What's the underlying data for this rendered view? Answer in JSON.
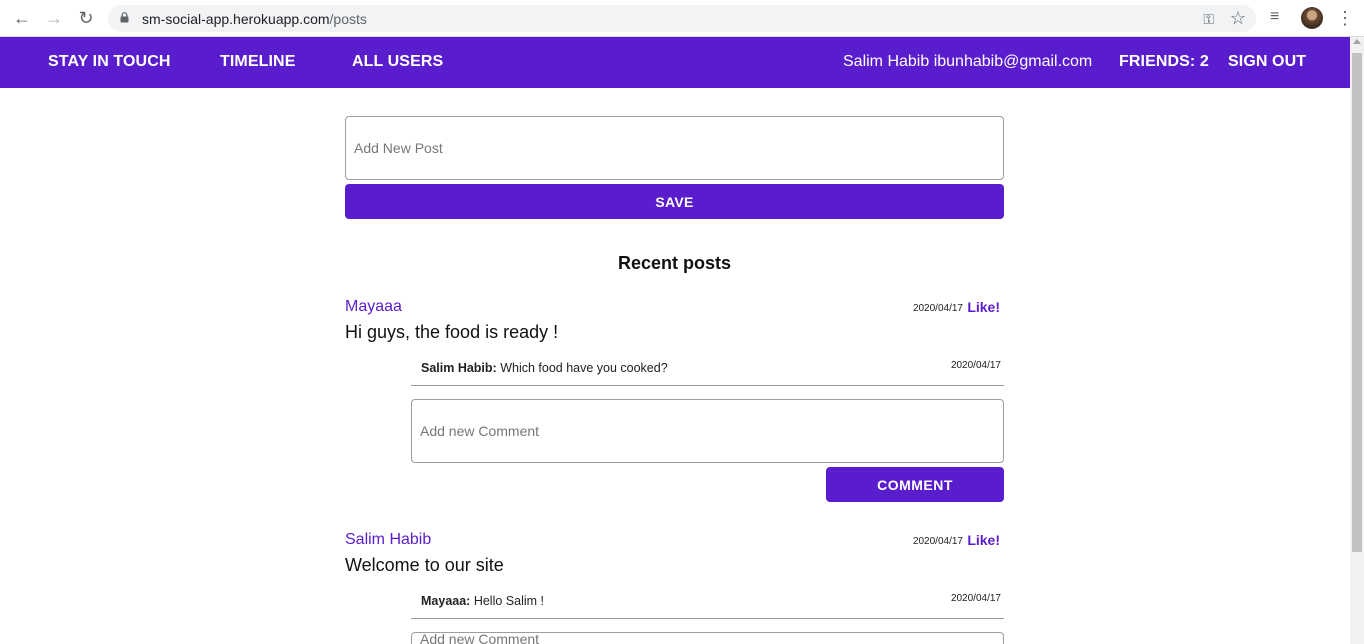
{
  "browser": {
    "url_host": "sm-social-app.herokuapp.com",
    "url_path": "/posts",
    "back_icon": "←",
    "forward_icon": "→",
    "reload_icon": "↻",
    "key_icon": "⚿",
    "star_icon": "☆",
    "ext_icon": "≡",
    "menu_icon": "⋮"
  },
  "navbar": {
    "brand": "STAY IN TOUCH",
    "timeline": "TIMELINE",
    "all_users": "ALL USERS",
    "user_info": "Salim Habib ibunhabib@gmail.com",
    "friends": "FRIENDS: 2",
    "sign_out": "SIGN OUT"
  },
  "new_post": {
    "placeholder": "Add New Post",
    "save_label": "SAVE"
  },
  "recent_title": "Recent posts",
  "posts": [
    {
      "author": "Mayaaa",
      "date": "2020/04/17",
      "like_label": "Like!",
      "body": "Hi guys, the food is ready !",
      "comment": {
        "author": "Salim Habib:",
        "text": " Which food have you cooked?",
        "date": "2020/04/17"
      },
      "comment_placeholder": "Add new Comment",
      "comment_button": "COMMENT"
    },
    {
      "author": "Salim Habib",
      "date": "2020/04/17",
      "like_label": "Like!",
      "body": "Welcome to our site",
      "comment": {
        "author": "Mayaaa:",
        "text": " Hello Salim !",
        "date": "2020/04/17"
      },
      "comment_placeholder": "Add new Comment"
    }
  ],
  "colors": {
    "accent": "#5a1dcd"
  }
}
